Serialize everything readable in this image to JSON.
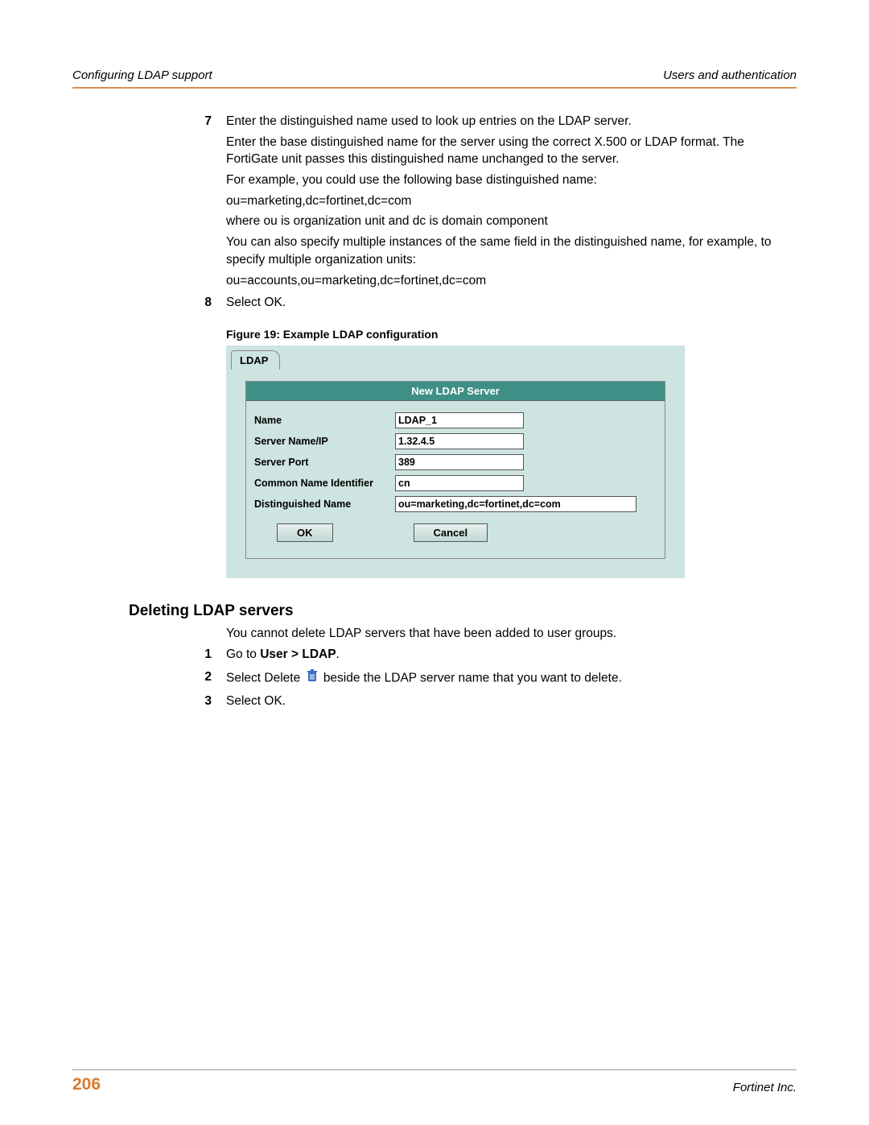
{
  "header": {
    "left": "Configuring LDAP support",
    "right": "Users and authentication"
  },
  "steps7": {
    "num": "7",
    "p1": "Enter the distinguished name used to look up entries on the LDAP server.",
    "p2": "Enter the base distinguished name for the server using the correct X.500 or LDAP format. The FortiGate unit passes this distinguished name unchanged to the server.",
    "p3": "For example, you could use the following base distinguished name:",
    "p4": "ou=marketing,dc=fortinet,dc=com",
    "p5": "where ou is organization unit and dc is domain component",
    "p6": "You can also specify multiple instances of the same field in the distinguished name, for example, to specify multiple organization units:",
    "p7": "ou=accounts,ou=marketing,dc=fortinet,dc=com"
  },
  "steps8": {
    "num": "8",
    "p1": "Select OK."
  },
  "figure": {
    "caption": "Figure 19: Example LDAP configuration",
    "tab": "LDAP",
    "title": "New LDAP Server",
    "labels": {
      "name": "Name",
      "server": "Server Name/IP",
      "port": "Server Port",
      "cni": "Common Name Identifier",
      "dn": "Distinguished Name"
    },
    "values": {
      "name": "LDAP_1",
      "server": "1.32.4.5",
      "port": "389",
      "cni": "cn",
      "dn": "ou=marketing,dc=fortinet,dc=com"
    },
    "buttons": {
      "ok": "OK",
      "cancel": "Cancel"
    }
  },
  "deleting": {
    "heading": "Deleting LDAP servers",
    "intro": "You cannot delete LDAP servers that have been added to user groups.",
    "step1": {
      "num": "1",
      "pre": "Go to ",
      "bold": "User > LDAP",
      "post": "."
    },
    "step2": {
      "num": "2",
      "pre": "Select Delete ",
      "post": " beside the LDAP server name that you want to delete."
    },
    "step3": {
      "num": "3",
      "text": "Select OK."
    }
  },
  "footer": {
    "page": "206",
    "company": "Fortinet Inc."
  }
}
